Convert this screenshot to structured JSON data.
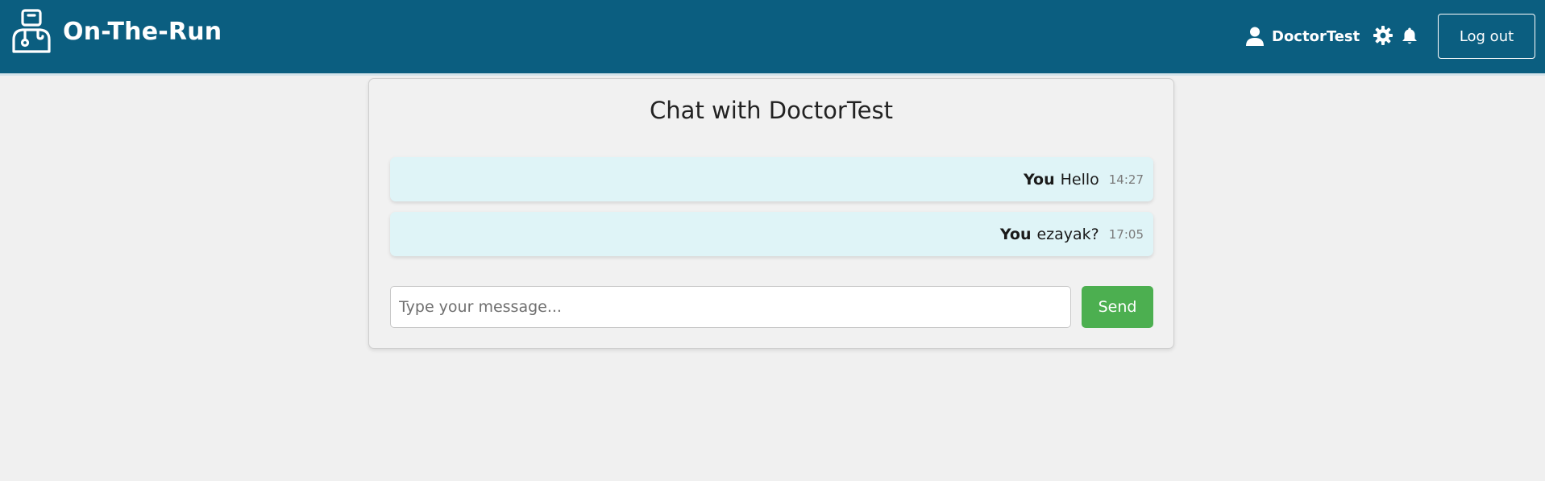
{
  "header": {
    "brand_name": "On-The-Run",
    "brand_icon": "doctor-logo-icon",
    "username": "DoctorTest",
    "user_icon": "user-icon",
    "settings_icon": "gear-icon",
    "notifications_icon": "bell-icon",
    "logout_label": "Log out",
    "background_color": "#0b5e80"
  },
  "chat": {
    "title": "Chat with DoctorTest",
    "messages": [
      {
        "sender": "You",
        "text": "Hello",
        "time": "14:27"
      },
      {
        "sender": "You",
        "text": "ezayak?",
        "time": "17:05"
      }
    ],
    "input_placeholder": "Type your message...",
    "input_value": "",
    "send_label": "Send",
    "send_color": "#4caf50",
    "message_bg_color": "#dff4f7"
  }
}
